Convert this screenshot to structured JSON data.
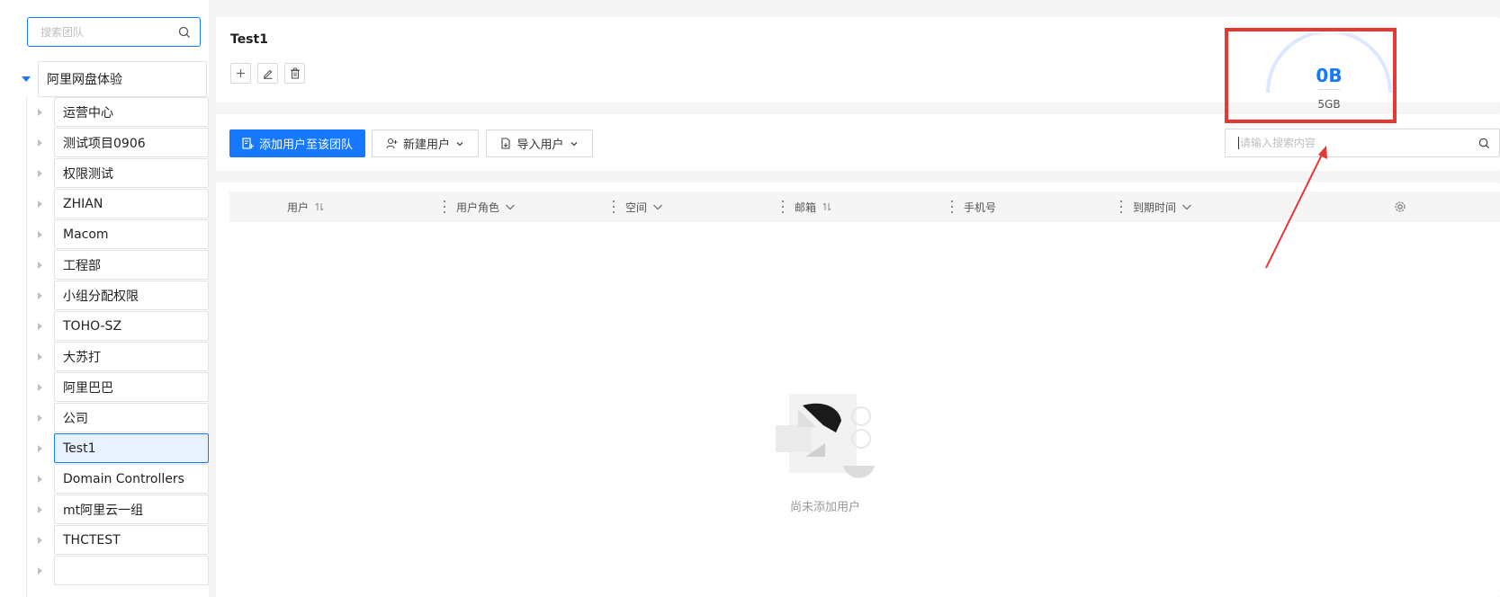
{
  "sidebar": {
    "search": {
      "placeholder": "搜索团队"
    },
    "root_label": "阿里网盘体验",
    "items": [
      {
        "label": "运营中心"
      },
      {
        "label": "测试项目0906"
      },
      {
        "label": "权限测试"
      },
      {
        "label": "ZHIAN"
      },
      {
        "label": "Macom"
      },
      {
        "label": "工程部"
      },
      {
        "label": "小组分配权限"
      },
      {
        "label": "TOHO-SZ"
      },
      {
        "label": "大苏打"
      },
      {
        "label": "阿里巴巴"
      },
      {
        "label": "公司"
      },
      {
        "label": "Test1"
      },
      {
        "label": "Domain Controllers"
      },
      {
        "label": "mt阿里云一组"
      },
      {
        "label": "THCTEST"
      },
      {
        "label": ""
      }
    ],
    "selected": "Test1"
  },
  "team": {
    "title": "Test1",
    "storage_used": "0B",
    "storage_total": "5GB"
  },
  "actions": {
    "add_to_team": "添加用户至该团队",
    "new_user": "新建用户",
    "import_users": "导入用户",
    "search_placeholder": "请输入搜索内容"
  },
  "table": {
    "columns": [
      {
        "label": "用户",
        "sort": "sort-icon"
      },
      {
        "label": "用户角色",
        "sort": "chevron-down-icon"
      },
      {
        "label": "空间",
        "sort": "chevron-down-icon"
      },
      {
        "label": "邮箱",
        "sort": "sort-icon"
      },
      {
        "label": "手机号",
        "sort": ""
      },
      {
        "label": "到期时间",
        "sort": "chevron-down-icon"
      }
    ],
    "empty_text": "尚未添加用户"
  },
  "colors": {
    "accent": "#1677ff",
    "annotation": "#e53935"
  }
}
